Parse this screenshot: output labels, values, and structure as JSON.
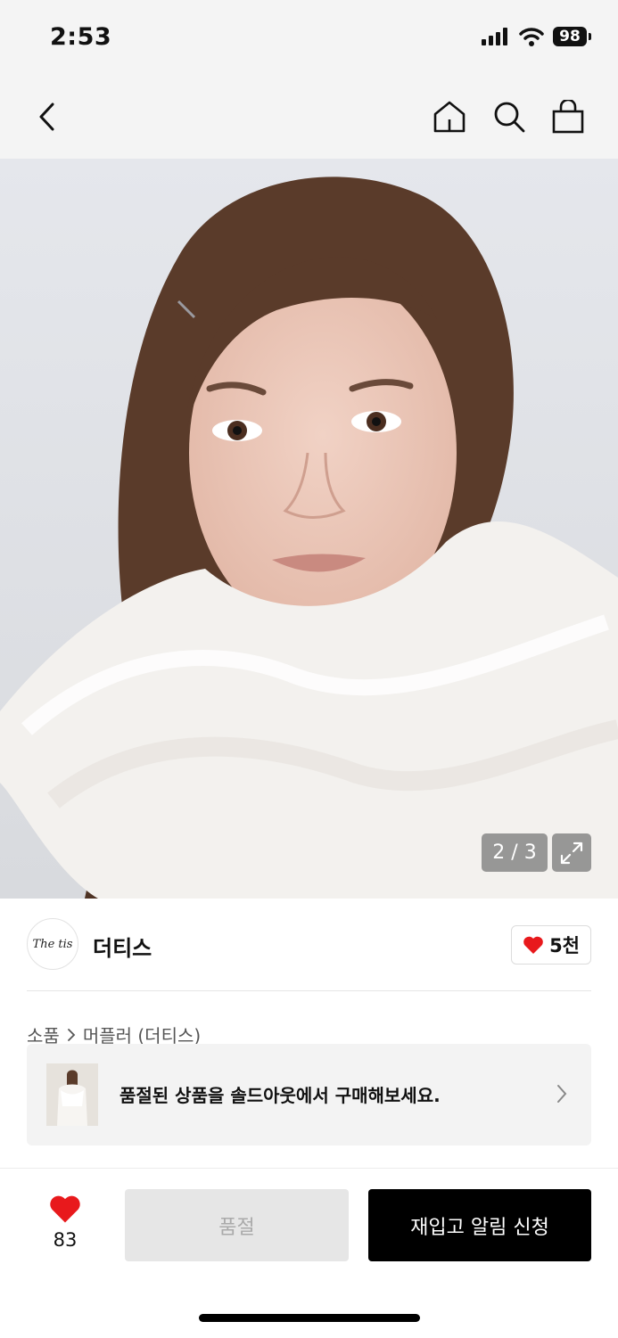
{
  "status_bar": {
    "time": "2:53",
    "battery": "98"
  },
  "nav": {
    "back_icon": "chevron-left-icon",
    "home_icon": "home-icon",
    "search_icon": "search-icon",
    "cart_icon": "shopping-bag-icon"
  },
  "gallery": {
    "counter": "2 / 3",
    "current_index": 2,
    "total": 3,
    "expand_icon": "expand-icon"
  },
  "brand": {
    "logo_text": "The tis",
    "name": "더티스",
    "like_count": "5천",
    "heart_color": "#e8191c"
  },
  "breadcrumb": {
    "category": "소품",
    "subcategory": "머플러 (더티스)"
  },
  "promo": {
    "text": "품절된 상품을 솔드아웃에서 구매해보세요."
  },
  "bottom": {
    "like_count": "83",
    "soldout_label": "품절",
    "restock_label": "재입고 알림 신청"
  }
}
